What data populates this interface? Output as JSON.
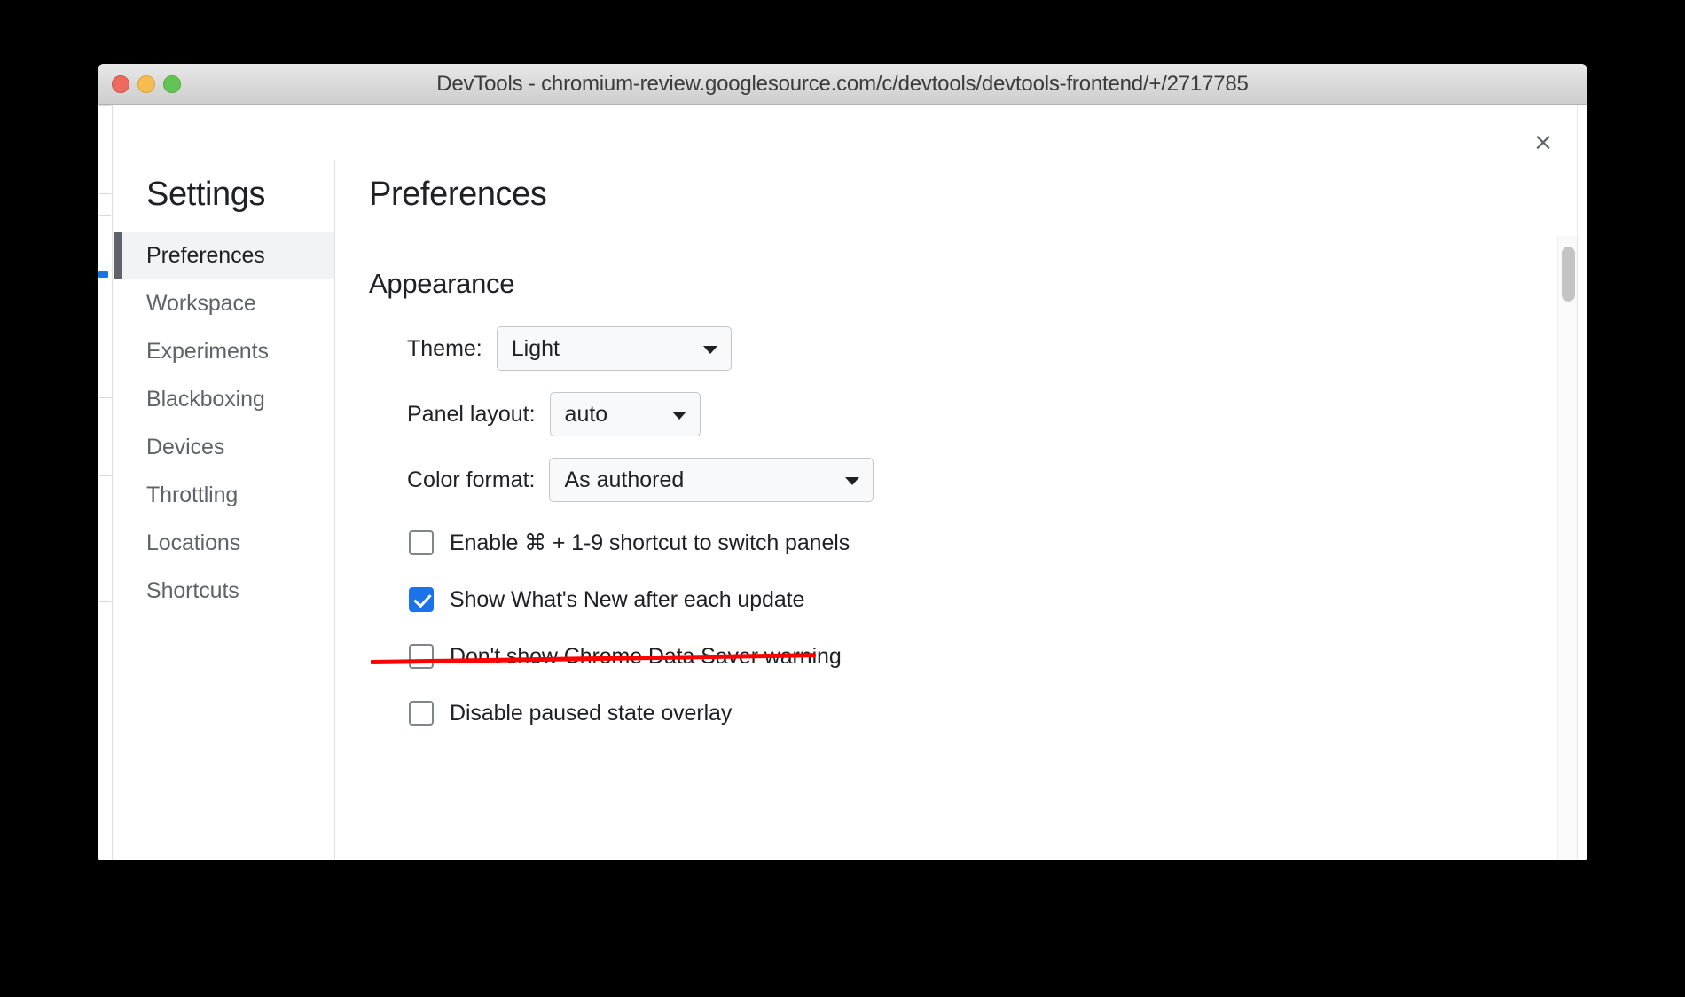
{
  "window": {
    "title": "DevTools - chromium-review.googlesource.com/c/devtools/devtools-frontend/+/2717785",
    "traffic_lights": [
      "close",
      "minimize",
      "zoom"
    ],
    "colors": {
      "close": "#ee6a5f",
      "minimize": "#f5bd4f",
      "zoom": "#61c454"
    }
  },
  "dialog": {
    "close_label": "×",
    "sidebar": {
      "heading": "Settings",
      "items": [
        {
          "label": "Preferences",
          "selected": true
        },
        {
          "label": "Workspace",
          "selected": false
        },
        {
          "label": "Experiments",
          "selected": false
        },
        {
          "label": "Blackboxing",
          "selected": false
        },
        {
          "label": "Devices",
          "selected": false
        },
        {
          "label": "Throttling",
          "selected": false
        },
        {
          "label": "Locations",
          "selected": false
        },
        {
          "label": "Shortcuts",
          "selected": false
        }
      ]
    },
    "content": {
      "header": "Preferences",
      "section_title": "Appearance",
      "fields": [
        {
          "label": "Theme:",
          "value": "Light"
        },
        {
          "label": "Panel layout:",
          "value": "auto"
        },
        {
          "label": "Color format:",
          "value": "As authored"
        }
      ],
      "checkboxes": [
        {
          "label": "Enable ⌘ + 1-9 shortcut to switch panels",
          "checked": false,
          "struck": false
        },
        {
          "label": "Show What's New after each update",
          "checked": true,
          "struck": false
        },
        {
          "label": "Don't show Chrome Data Saver warning",
          "checked": false,
          "struck": true
        },
        {
          "label": "Disable paused state overlay",
          "checked": false,
          "struck": false
        }
      ]
    }
  },
  "annotation": {
    "strike_color": "#ff0000"
  },
  "accent": {
    "checkbox_checked": "#1a73e8",
    "selected_nav_bar": "#5f6368",
    "selected_nav_bg": "#f1f3f4"
  }
}
